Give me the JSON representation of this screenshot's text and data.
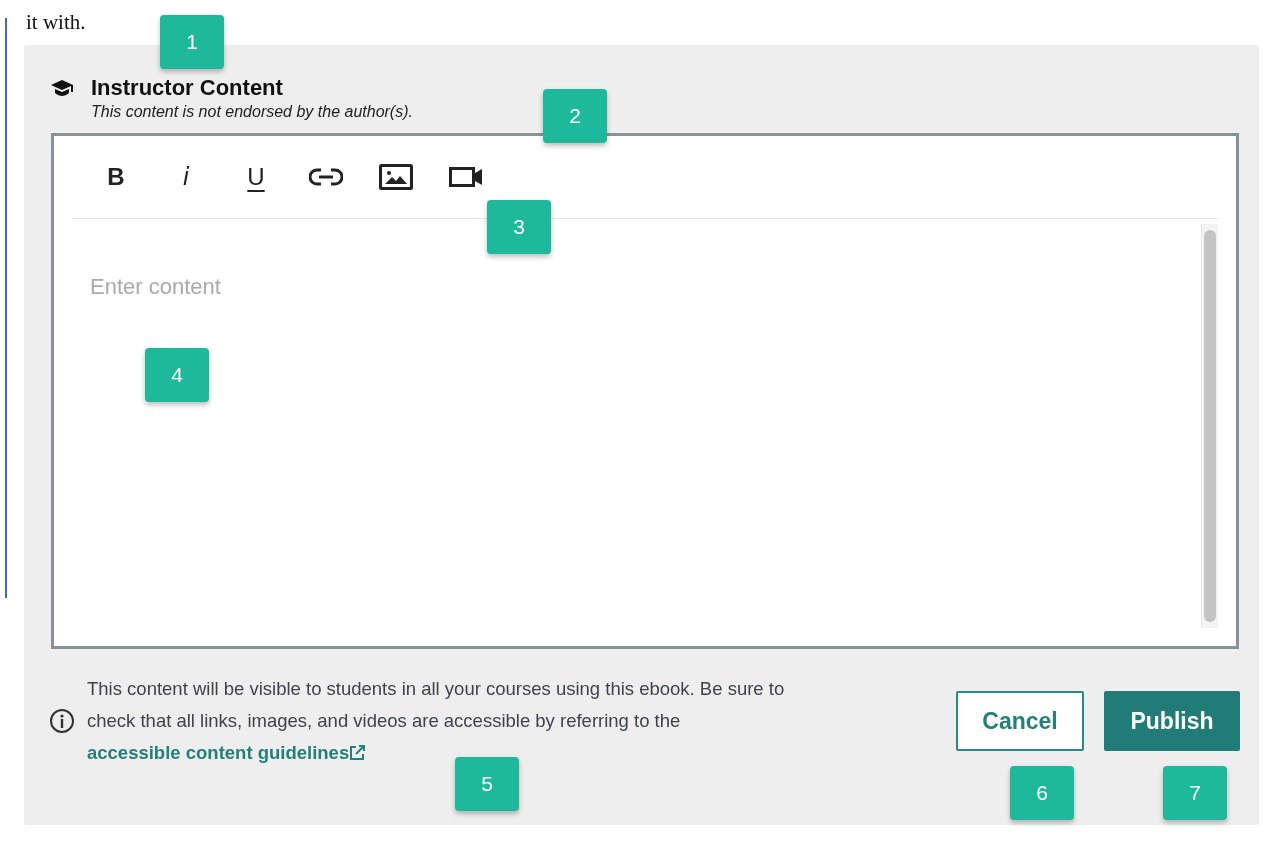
{
  "page_text": "it with.",
  "panel": {
    "title": "Instructor Content",
    "subtitle": "This content is not endorsed by the author(s).",
    "toolbar": [
      {
        "kind": "bold",
        "label": "B"
      },
      {
        "kind": "italic",
        "label": "i"
      },
      {
        "kind": "underline",
        "label": "U"
      },
      {
        "kind": "link"
      },
      {
        "kind": "image"
      },
      {
        "kind": "video"
      }
    ],
    "editor": {
      "placeholder": "Enter content"
    },
    "notice": {
      "text": "This content will be visible to students in all your courses using this ebook. Be sure to check that all links, images, and videos are accessible by referring to the",
      "link": "accessible content guidelines"
    },
    "buttons": [
      {
        "kind": "secondary",
        "label": "Cancel"
      },
      {
        "kind": "primary",
        "label": "Publish"
      }
    ]
  },
  "callouts": [
    {
      "label": "1"
    },
    {
      "label": "2"
    },
    {
      "label": "3"
    },
    {
      "label": "4"
    },
    {
      "label": "5"
    },
    {
      "label": "6"
    },
    {
      "label": "7"
    }
  ]
}
